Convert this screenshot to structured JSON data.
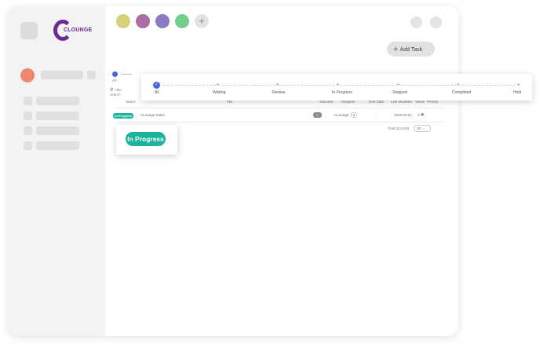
{
  "brand": {
    "logo_text": "CLOUNGE"
  },
  "toolbar": {
    "color_dots": [
      "#d7d27a",
      "#a86ea3",
      "#8f78c4",
      "#72cf8e"
    ],
    "add_task_label": "Add Task"
  },
  "filter": {
    "mini_all": "All",
    "search_placeholder": "Title search"
  },
  "status_steps": [
    "All",
    "Waiting",
    "Review",
    "In Progress",
    "Stopped",
    "Completed",
    "Hold"
  ],
  "table": {
    "headers": [
      "Status",
      "Title",
      "Sub task",
      "Assignee",
      "Due Date",
      "Last Modified",
      "Views",
      "Priority"
    ],
    "rows": [
      {
        "status": "In Progress",
        "title": "CLounge Sales",
        "subtask": "4",
        "assignee": "CLounge",
        "assignee_count": "3",
        "due_date": "-",
        "last_modified": "2023.03.21",
        "views": "3"
      }
    ],
    "total": "Total 1(count)",
    "page_size": "10"
  },
  "callout_badge": "In Progress",
  "colors": {
    "accent": "#1ab39b",
    "step_check": "#4a63d8",
    "brand": "#6a2c91",
    "avatar": "#f08571"
  }
}
